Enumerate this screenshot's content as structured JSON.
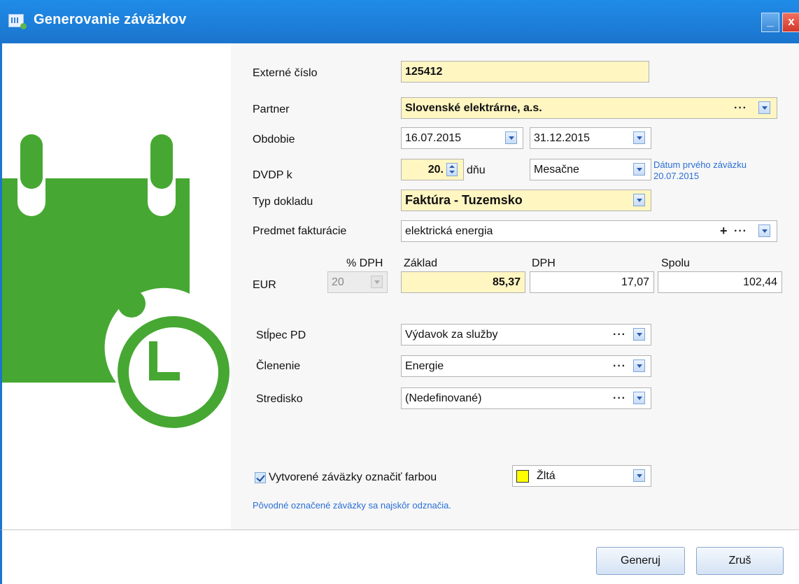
{
  "window": {
    "title": "Generovanie záväzkov",
    "minimize": "_",
    "close": "x"
  },
  "colors": {
    "accent": "#1b74cd",
    "icon_green": "#46a832",
    "required_field": "#fff6c2",
    "link": "#2a6ed6"
  },
  "icons": {
    "app": "app-icon",
    "illustration": "calendar-clock-icon"
  },
  "form": {
    "external_number": {
      "label": "Externé číslo",
      "value": "125412"
    },
    "partner": {
      "label": "Partner",
      "value": "Slovenské elektrárne, a.s.",
      "more": "···"
    },
    "period": {
      "label": "Obdobie",
      "from": "16.07.2015",
      "to": "31.12.2015"
    },
    "dvdp": {
      "label": "DVDP k",
      "day": "20.",
      "unit": "dňu",
      "frequency": "Mesačne"
    },
    "first_liability": {
      "label": "Dátum prvého záväzku",
      "date": "20.07.2015"
    },
    "doc_type": {
      "label": "Typ dokladu",
      "value": "Faktúra - Tuzemsko"
    },
    "subject": {
      "label": "Predmet fakturácie",
      "value": "elektrická energia",
      "add": "+",
      "more": "···"
    },
    "amounts": {
      "currency": "EUR",
      "vat_rate_header": "% DPH",
      "vat_rate": "20",
      "base_header": "Základ",
      "base": "85,37",
      "vat_header": "DPH",
      "vat": "17,07",
      "total_header": "Spolu",
      "total": "102,44"
    },
    "pd_column": {
      "label": "Stĺpec PD",
      "value": "Výdavok za služby",
      "more": "···"
    },
    "division": {
      "label": "Členenie",
      "value": "Energie",
      "more": "···"
    },
    "center": {
      "label": "Stredisko",
      "value": "(Nedefinované)",
      "more": "···"
    },
    "mark_color": {
      "checked": true,
      "label": "Vytvorené záväzky označiť farbou",
      "color_name": "Žltá",
      "color": "#ffff00"
    },
    "note": "Pôvodné označené záväzky sa najskôr odznačia."
  },
  "buttons": {
    "generate": "Generuj",
    "cancel": "Zruš"
  }
}
